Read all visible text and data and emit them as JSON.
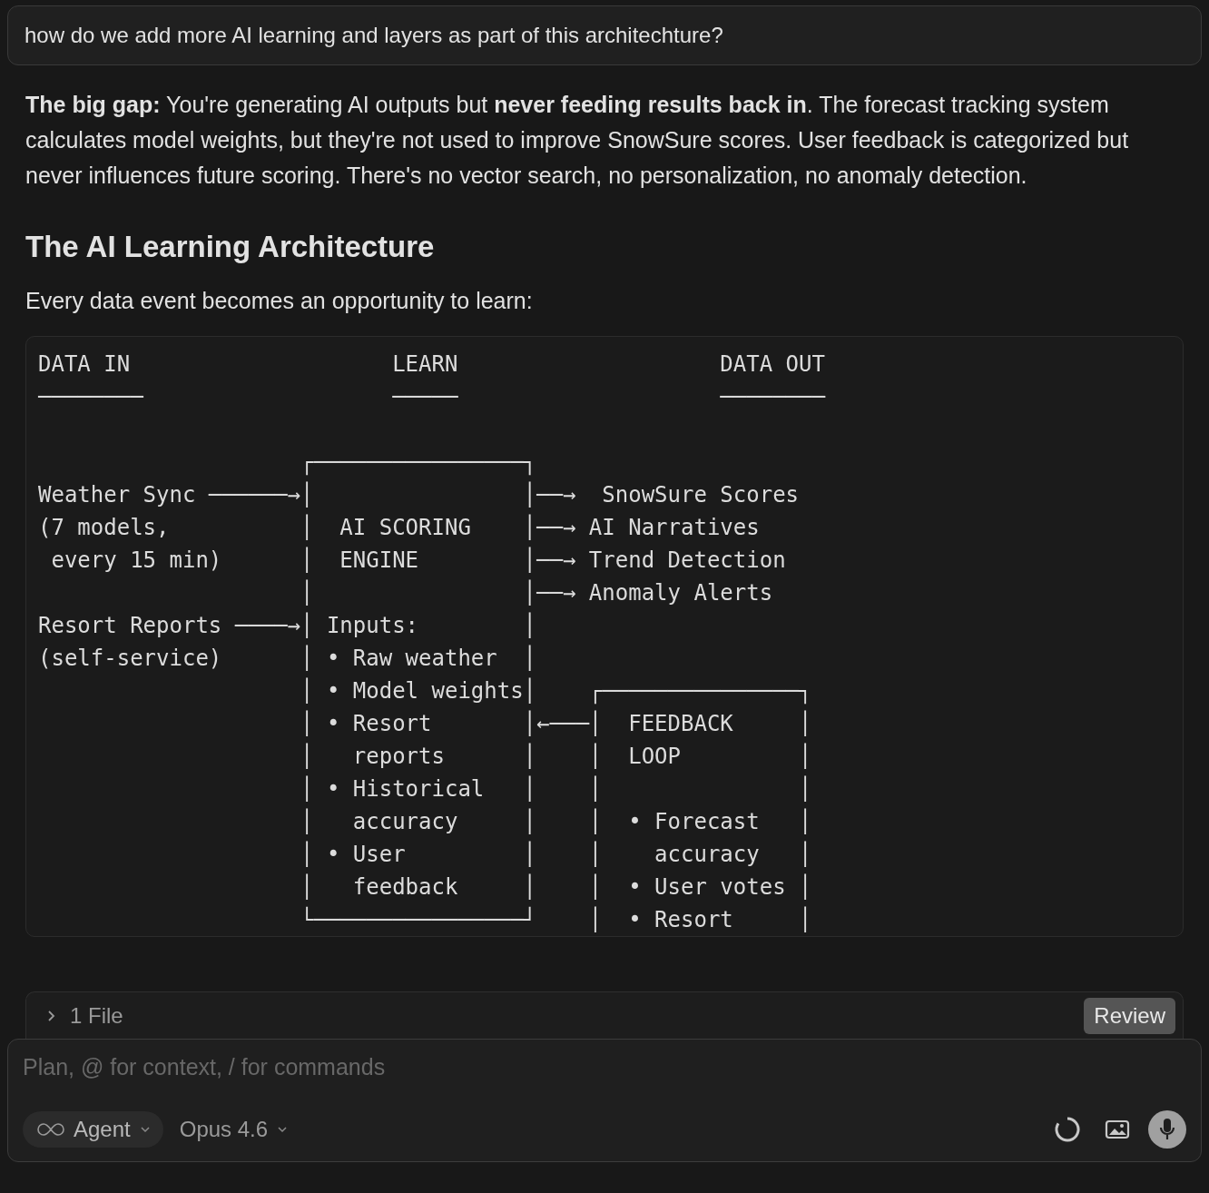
{
  "user_message": "how do we add more AI learning and layers as part of this architechture?",
  "answer": {
    "paragraph": "**The big gap:** You're generating AI outputs but **never feeding results back in**. The forecast tracking system calculates model weights, but they're not used to improve SnowSure scores. User feedback is categorized but never influences future scoring. There's no vector search, no personalization, no anomaly detection.",
    "heading": "The AI Learning Architecture",
    "intro": "Every data event becomes an opportunity to learn:",
    "code_header": [
      "DATA IN                    LEARN                    DATA OUT",
      "────────                   ─────                    ────────"
    ],
    "code_lines": [
      "                    ┌────────────────┐",
      "Weather Sync ──────→│                │──→  SnowSure Scores",
      "(7 models,          │  AI SCORING    │──→ AI Narratives",
      " every 15 min)      │  ENGINE        │──→ Trend Detection",
      "                    │                │──→ Anomaly Alerts",
      "Resort Reports ────→│ Inputs:        │",
      "(self-service)      │ • Raw weather  │",
      "                    │ • Model weights│    ┌───────────────┐",
      "                    │ • Resort       │←───│  FEEDBACK     │",
      "                    │   reports      │    │  LOOP         │",
      "                    │ • Historical   │    │               │",
      "                    │   accuracy     │    │  • Forecast   │",
      "                    │ • User         │    │    accuracy   │",
      "                    │   feedback     │    │  • User votes │",
      "                    └────────────────┘    │  • Resort     │"
    ]
  },
  "changes_bar": {
    "expanded": false,
    "label": "1 File",
    "review_button": "Review"
  },
  "composer": {
    "placeholder": "Plan, @ for context, / for commands",
    "mode": "Agent",
    "model": "Opus 4.6"
  }
}
